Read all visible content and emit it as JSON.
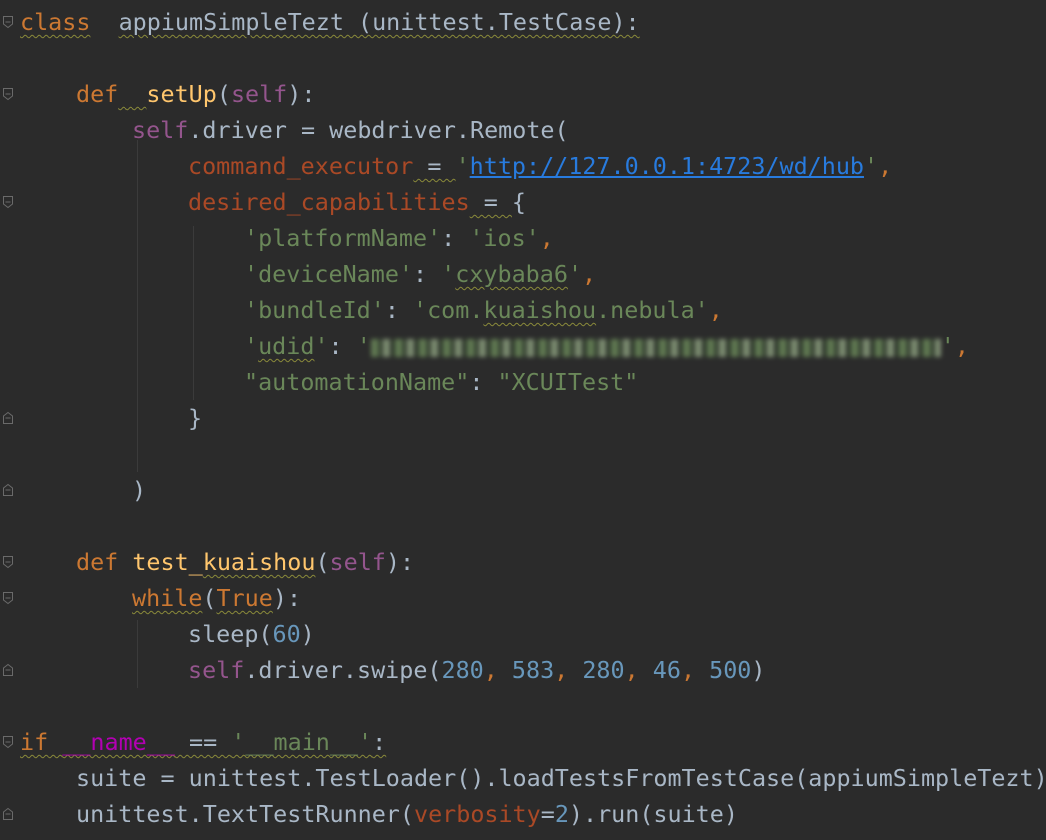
{
  "editor": {
    "lines": [
      {
        "indent": 0,
        "fold": "open",
        "tokens": [
          {
            "t": "class",
            "c": "kw squig"
          },
          {
            "t": "  ",
            "c": "plain"
          },
          {
            "t": "appiumSimpleTezt (unittest.TestCase):",
            "c": "plain squig"
          }
        ]
      },
      {
        "indent": 0,
        "tokens": []
      },
      {
        "indent": 1,
        "fold": "open",
        "tokens": [
          {
            "t": "def",
            "c": "kw"
          },
          {
            "t": "  ",
            "c": "plain squig"
          },
          {
            "t": "setUp",
            "c": "fn"
          },
          {
            "t": "(",
            "c": "plain"
          },
          {
            "t": "self",
            "c": "slf"
          },
          {
            "t": "):",
            "c": "plain"
          }
        ]
      },
      {
        "indent": 2,
        "tokens": [
          {
            "t": "self",
            "c": "slf"
          },
          {
            "t": ".driver = webdriver.Remote(",
            "c": "plain"
          }
        ]
      },
      {
        "indent": 3,
        "tokens": [
          {
            "t": "command_executor",
            "c": "par"
          },
          {
            "t": " = ",
            "c": "plain squig"
          },
          {
            "t": "'",
            "c": "str"
          },
          {
            "t": "http://127.0.0.1:4723/wd/hub",
            "c": "url"
          },
          {
            "t": "'",
            "c": "str"
          },
          {
            "t": ",",
            "c": "kw"
          }
        ]
      },
      {
        "indent": 3,
        "fold": "open",
        "tokens": [
          {
            "t": "desired_capabilities",
            "c": "par"
          },
          {
            "t": " = ",
            "c": "plain squig"
          },
          {
            "t": "{",
            "c": "plain"
          }
        ]
      },
      {
        "indent": 4,
        "tokens": [
          {
            "t": "'platformName'",
            "c": "str"
          },
          {
            "t": ": ",
            "c": "plain"
          },
          {
            "t": "'ios'",
            "c": "str"
          },
          {
            "t": ",",
            "c": "kw"
          }
        ]
      },
      {
        "indent": 4,
        "tokens": [
          {
            "t": "'deviceName'",
            "c": "str"
          },
          {
            "t": ": ",
            "c": "plain"
          },
          {
            "t": "'",
            "c": "str"
          },
          {
            "t": "cxybaba6",
            "c": "str squig"
          },
          {
            "t": "'",
            "c": "str"
          },
          {
            "t": ",",
            "c": "kw"
          }
        ]
      },
      {
        "indent": 4,
        "tokens": [
          {
            "t": "'bundleId'",
            "c": "str"
          },
          {
            "t": ": ",
            "c": "plain"
          },
          {
            "t": "'com.",
            "c": "str"
          },
          {
            "t": "kuaishou",
            "c": "str squig"
          },
          {
            "t": ".nebula'",
            "c": "str"
          },
          {
            "t": ",",
            "c": "kw"
          }
        ]
      },
      {
        "indent": 4,
        "tokens": [
          {
            "t": "'",
            "c": "str"
          },
          {
            "t": "udid",
            "c": "str squig"
          },
          {
            "t": "'",
            "c": "str"
          },
          {
            "t": ": ",
            "c": "plain"
          },
          {
            "t": "'",
            "c": "str"
          },
          {
            "redacted": true
          },
          {
            "t": "'",
            "c": "str"
          },
          {
            "t": ",",
            "c": "kw"
          }
        ]
      },
      {
        "indent": 4,
        "tokens": [
          {
            "t": "\"automationName\"",
            "c": "str"
          },
          {
            "t": ": ",
            "c": "plain"
          },
          {
            "t": "\"XCUITest\"",
            "c": "str"
          }
        ]
      },
      {
        "indent": 3,
        "fold": "close",
        "tokens": [
          {
            "t": "}",
            "c": "plain"
          }
        ]
      },
      {
        "indent": 0,
        "tokens": []
      },
      {
        "indent": 2,
        "fold": "close",
        "tokens": [
          {
            "t": ")",
            "c": "plain"
          }
        ]
      },
      {
        "indent": 0,
        "tokens": []
      },
      {
        "indent": 1,
        "fold": "open",
        "tokens": [
          {
            "t": "def",
            "c": "kw"
          },
          {
            "t": " ",
            "c": "plain"
          },
          {
            "t": "test_",
            "c": "fn"
          },
          {
            "t": "kuaishou",
            "c": "fn squig"
          },
          {
            "t": "(",
            "c": "plain"
          },
          {
            "t": "self",
            "c": "slf"
          },
          {
            "t": "):",
            "c": "plain"
          }
        ]
      },
      {
        "indent": 2,
        "fold": "open",
        "tokens": [
          {
            "t": "while",
            "c": "kw squig"
          },
          {
            "t": "(",
            "c": "plain"
          },
          {
            "t": "True",
            "c": "kw squig"
          },
          {
            "t": "):",
            "c": "plain"
          }
        ]
      },
      {
        "indent": 3,
        "tokens": [
          {
            "t": "sleep(",
            "c": "plain"
          },
          {
            "t": "60",
            "c": "num"
          },
          {
            "t": ")",
            "c": "plain"
          }
        ]
      },
      {
        "indent": 3,
        "fold": "close",
        "tokens": [
          {
            "t": "self",
            "c": "slf"
          },
          {
            "t": ".driver.swipe(",
            "c": "plain"
          },
          {
            "t": "280",
            "c": "num"
          },
          {
            "t": ", ",
            "c": "kw"
          },
          {
            "t": "583",
            "c": "num"
          },
          {
            "t": ", ",
            "c": "kw"
          },
          {
            "t": "280",
            "c": "num"
          },
          {
            "t": ", ",
            "c": "kw"
          },
          {
            "t": "46",
            "c": "num"
          },
          {
            "t": ", ",
            "c": "kw"
          },
          {
            "t": "500",
            "c": "num"
          },
          {
            "t": ")",
            "c": "plain"
          }
        ]
      },
      {
        "indent": 0,
        "tokens": []
      },
      {
        "indent": 0,
        "fold": "open",
        "tokens": [
          {
            "t": "if",
            "c": "kw squig"
          },
          {
            "t": " ",
            "c": "plain squig"
          },
          {
            "t": "__name__",
            "c": "dunder squig"
          },
          {
            "t": " == ",
            "c": "plain squig"
          },
          {
            "t": "'__main__'",
            "c": "str squig"
          },
          {
            "t": ":",
            "c": "plain squig"
          }
        ]
      },
      {
        "indent": 1,
        "tokens": [
          {
            "t": "suite = unittest.TestLoader().loadTestsFromTestCase(appiumSimpleTezt)",
            "c": "plain"
          }
        ]
      },
      {
        "indent": 1,
        "fold": "close",
        "tokens": [
          {
            "t": "unittest.TextTestRunner(",
            "c": "plain"
          },
          {
            "t": "verbosity",
            "c": "par"
          },
          {
            "t": "=",
            "c": "plain"
          },
          {
            "t": "2",
            "c": "num"
          },
          {
            "t": ").run(suite)",
            "c": "plain"
          }
        ]
      }
    ]
  },
  "colors": {
    "background": "#2b2b2b",
    "keyword": "#cc7832",
    "function": "#ffc66d",
    "self": "#94558d",
    "parameter": "#aa4926",
    "string": "#6a8759",
    "number": "#6897bb",
    "url": "#287bde",
    "dunder": "#b200b2",
    "text": "#a9b7c6"
  }
}
